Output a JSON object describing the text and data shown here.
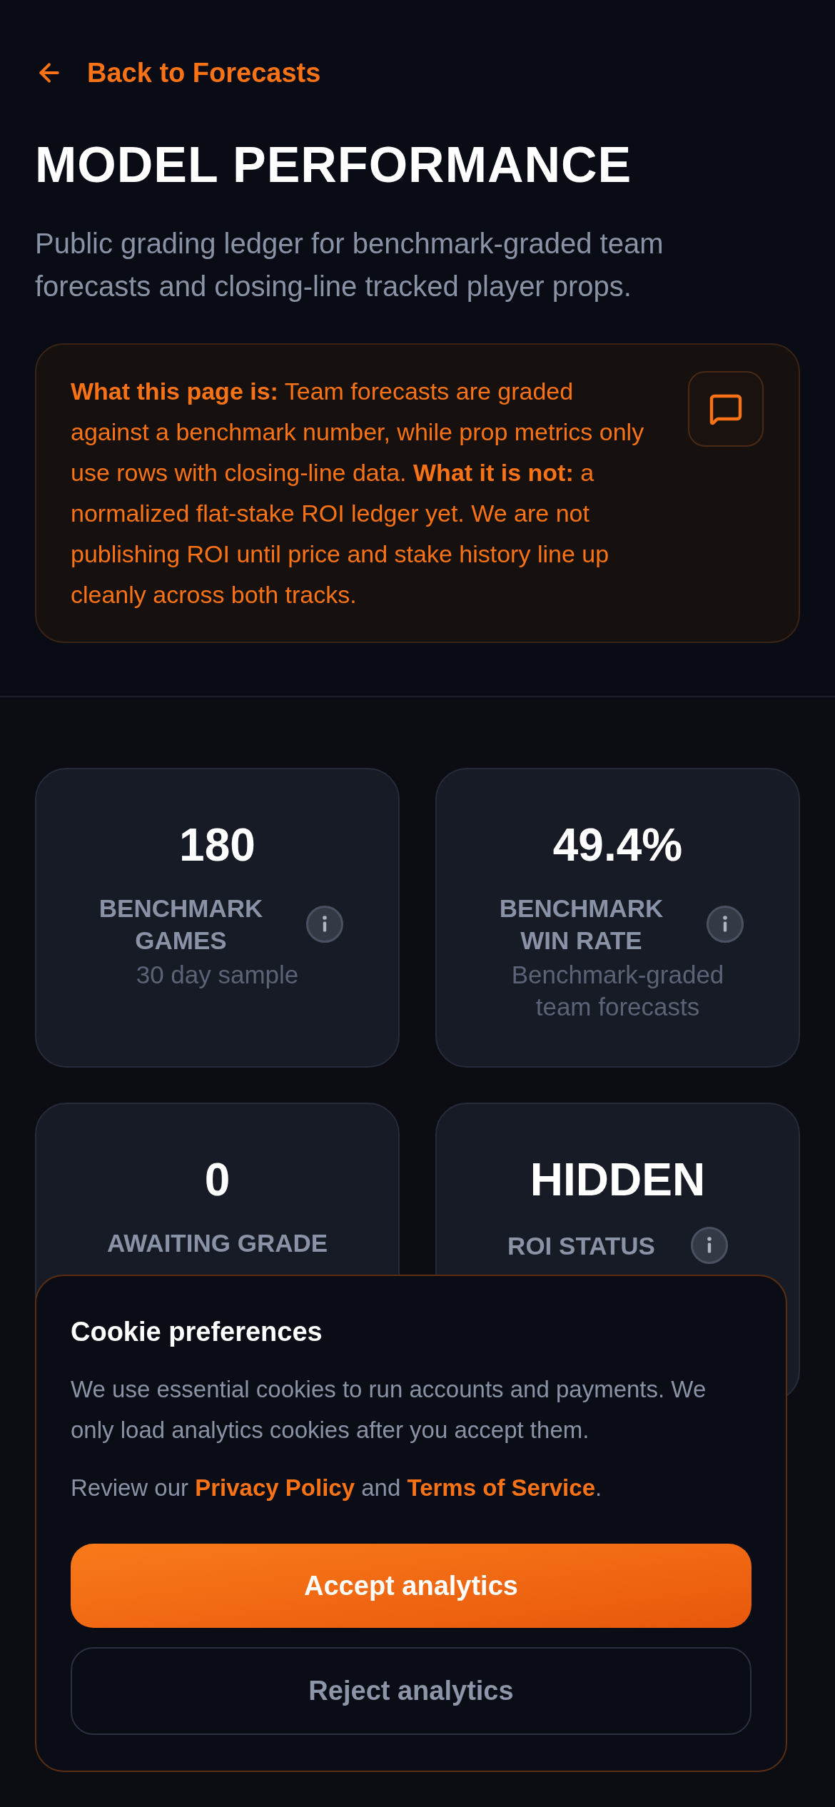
{
  "back_link": {
    "label": "Back to Forecasts"
  },
  "header": {
    "title": "MODEL PERFORMANCE",
    "subtitle": "Public grading ledger for benchmark-graded team forecasts and closing-line tracked player props."
  },
  "notice": {
    "text": "**What this page is:** Team forecasts are graded against a benchmark number, while prop metrics only use rows with closing-line data. **What it is not:** a normalized flat-stake ROI ledger yet. We are not publishing ROI until price and stake history line up cleanly across both tracks."
  },
  "stats": [
    {
      "value": "180",
      "label": "BENCHMARK GAMES",
      "note": "30 day sample",
      "info": true
    },
    {
      "value": "49.4%",
      "label": "BENCHMARK WIN RATE",
      "note": "Benchmark-graded team forecasts",
      "info": true
    },
    {
      "value": "0",
      "label": "AWAITING GRADE",
      "info": false
    },
    {
      "value": "HIDDEN",
      "label": "ROI STATUS",
      "info": true
    }
  ],
  "cookie_banner": {
    "title": "Cookie preferences",
    "body": "We use essential cookies to run accounts and payments. We only load analytics cookies after you accept them.",
    "review": [
      {
        "kind": "text",
        "text": "Review our "
      },
      {
        "kind": "link",
        "text": "Privacy Policy"
      },
      {
        "kind": "text",
        "text": " and "
      },
      {
        "kind": "link",
        "text": "Terms of Service"
      },
      {
        "kind": "text",
        "text": "."
      }
    ],
    "buttons": [
      {
        "label": "Accept analytics",
        "kind": "primary"
      },
      {
        "label": "Reject analytics",
        "kind": "secondary"
      }
    ]
  }
}
